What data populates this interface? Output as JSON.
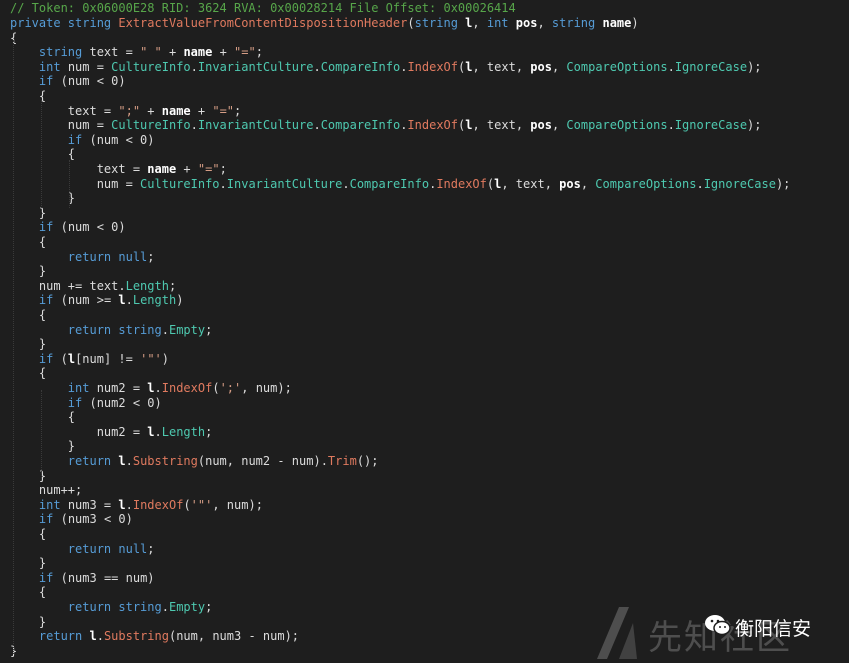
{
  "header_comment": "// Token: 0x06000E28 RID: 3624 RVA: 0x00028214 File Offset: 0x00026414",
  "lines": [
    [
      [
        "kw",
        "private "
      ],
      [
        "kw",
        "string "
      ],
      [
        "fn",
        "ExtractValueFromContentDispositionHeader"
      ],
      [
        "t",
        "("
      ],
      [
        "kw",
        "string "
      ],
      [
        "nm",
        "l"
      ],
      [
        "t",
        ", "
      ],
      [
        "kw",
        "int "
      ],
      [
        "nm",
        "pos"
      ],
      [
        "t",
        ", "
      ],
      [
        "kw",
        "string "
      ],
      [
        "nm",
        "name"
      ],
      [
        "t",
        ")"
      ]
    ],
    [
      [
        "t",
        "{"
      ]
    ],
    [
      [
        "t",
        "    "
      ],
      [
        "kw",
        "string "
      ],
      [
        "t",
        "text = "
      ],
      [
        "st",
        "\" \""
      ],
      [
        "t",
        " + "
      ],
      [
        "nm",
        "name"
      ],
      [
        "t",
        " + "
      ],
      [
        "st",
        "\"=\""
      ],
      [
        "t",
        ";"
      ]
    ],
    [
      [
        "t",
        "    "
      ],
      [
        "kw",
        "int "
      ],
      [
        "t",
        "num = "
      ],
      [
        "ty",
        "CultureInfo"
      ],
      [
        "t",
        "."
      ],
      [
        "pr",
        "InvariantCulture"
      ],
      [
        "t",
        "."
      ],
      [
        "pr",
        "CompareInfo"
      ],
      [
        "t",
        "."
      ],
      [
        "fn",
        "IndexOf"
      ],
      [
        "t",
        "("
      ],
      [
        "nm",
        "l"
      ],
      [
        "t",
        ", text, "
      ],
      [
        "nm",
        "pos"
      ],
      [
        "t",
        ", "
      ],
      [
        "ty",
        "CompareOptions"
      ],
      [
        "t",
        "."
      ],
      [
        "pr",
        "IgnoreCase"
      ],
      [
        "t",
        ");"
      ]
    ],
    [
      [
        "t",
        "    "
      ],
      [
        "kw",
        "if "
      ],
      [
        "t",
        "(num < 0)"
      ]
    ],
    [
      [
        "t",
        "    {"
      ]
    ],
    [
      [
        "t",
        "        text = "
      ],
      [
        "st",
        "\";\""
      ],
      [
        "t",
        " + "
      ],
      [
        "nm",
        "name"
      ],
      [
        "t",
        " + "
      ],
      [
        "st",
        "\"=\""
      ],
      [
        "t",
        ";"
      ]
    ],
    [
      [
        "t",
        "        num = "
      ],
      [
        "ty",
        "CultureInfo"
      ],
      [
        "t",
        "."
      ],
      [
        "pr",
        "InvariantCulture"
      ],
      [
        "t",
        "."
      ],
      [
        "pr",
        "CompareInfo"
      ],
      [
        "t",
        "."
      ],
      [
        "fn",
        "IndexOf"
      ],
      [
        "t",
        "("
      ],
      [
        "nm",
        "l"
      ],
      [
        "t",
        ", text, "
      ],
      [
        "nm",
        "pos"
      ],
      [
        "t",
        ", "
      ],
      [
        "ty",
        "CompareOptions"
      ],
      [
        "t",
        "."
      ],
      [
        "pr",
        "IgnoreCase"
      ],
      [
        "t",
        ");"
      ]
    ],
    [
      [
        "t",
        "        "
      ],
      [
        "kw",
        "if "
      ],
      [
        "t",
        "(num < 0)"
      ]
    ],
    [
      [
        "t",
        "        {"
      ]
    ],
    [
      [
        "t",
        "            text = "
      ],
      [
        "nm",
        "name"
      ],
      [
        "t",
        " + "
      ],
      [
        "st",
        "\"=\""
      ],
      [
        "t",
        ";"
      ]
    ],
    [
      [
        "t",
        "            num = "
      ],
      [
        "ty",
        "CultureInfo"
      ],
      [
        "t",
        "."
      ],
      [
        "pr",
        "InvariantCulture"
      ],
      [
        "t",
        "."
      ],
      [
        "pr",
        "CompareInfo"
      ],
      [
        "t",
        "."
      ],
      [
        "fn",
        "IndexOf"
      ],
      [
        "t",
        "("
      ],
      [
        "nm",
        "l"
      ],
      [
        "t",
        ", text, "
      ],
      [
        "nm",
        "pos"
      ],
      [
        "t",
        ", "
      ],
      [
        "ty",
        "CompareOptions"
      ],
      [
        "t",
        "."
      ],
      [
        "pr",
        "IgnoreCase"
      ],
      [
        "t",
        ");"
      ]
    ],
    [
      [
        "t",
        "        }"
      ]
    ],
    [
      [
        "t",
        "    }"
      ]
    ],
    [
      [
        "t",
        "    "
      ],
      [
        "kw",
        "if "
      ],
      [
        "t",
        "(num < 0)"
      ]
    ],
    [
      [
        "t",
        "    {"
      ]
    ],
    [
      [
        "t",
        "        "
      ],
      [
        "kw",
        "return "
      ],
      [
        "kw",
        "null"
      ],
      [
        "t",
        ";"
      ]
    ],
    [
      [
        "t",
        "    }"
      ]
    ],
    [
      [
        "t",
        "    num += text."
      ],
      [
        "pr",
        "Length"
      ],
      [
        "t",
        ";"
      ]
    ],
    [
      [
        "t",
        "    "
      ],
      [
        "kw",
        "if "
      ],
      [
        "t",
        "(num >= "
      ],
      [
        "nm",
        "l"
      ],
      [
        "t",
        "."
      ],
      [
        "pr",
        "Length"
      ],
      [
        "t",
        ")"
      ]
    ],
    [
      [
        "t",
        "    {"
      ]
    ],
    [
      [
        "t",
        "        "
      ],
      [
        "kw",
        "return "
      ],
      [
        "kw",
        "string"
      ],
      [
        "t",
        "."
      ],
      [
        "pr",
        "Empty"
      ],
      [
        "t",
        ";"
      ]
    ],
    [
      [
        "t",
        "    }"
      ]
    ],
    [
      [
        "t",
        "    "
      ],
      [
        "kw",
        "if "
      ],
      [
        "t",
        "("
      ],
      [
        "nm",
        "l"
      ],
      [
        "t",
        "[num] != "
      ],
      [
        "st",
        "'\"'"
      ],
      [
        "t",
        ")"
      ]
    ],
    [
      [
        "t",
        "    {"
      ]
    ],
    [
      [
        "t",
        "        "
      ],
      [
        "kw",
        "int "
      ],
      [
        "t",
        "num2 = "
      ],
      [
        "nm",
        "l"
      ],
      [
        "t",
        "."
      ],
      [
        "fn",
        "IndexOf"
      ],
      [
        "t",
        "("
      ],
      [
        "st",
        "';'"
      ],
      [
        "t",
        ", num);"
      ]
    ],
    [
      [
        "t",
        "        "
      ],
      [
        "kw",
        "if "
      ],
      [
        "t",
        "(num2 < 0)"
      ]
    ],
    [
      [
        "t",
        "        {"
      ]
    ],
    [
      [
        "t",
        "            num2 = "
      ],
      [
        "nm",
        "l"
      ],
      [
        "t",
        "."
      ],
      [
        "pr",
        "Length"
      ],
      [
        "t",
        ";"
      ]
    ],
    [
      [
        "t",
        "        }"
      ]
    ],
    [
      [
        "t",
        "        "
      ],
      [
        "kw",
        "return "
      ],
      [
        "nm",
        "l"
      ],
      [
        "t",
        "."
      ],
      [
        "fn",
        "Substring"
      ],
      [
        "t",
        "(num, num2 - num)."
      ],
      [
        "fn",
        "Trim"
      ],
      [
        "t",
        "();"
      ]
    ],
    [
      [
        "t",
        "    }"
      ]
    ],
    [
      [
        "t",
        "    num++;"
      ]
    ],
    [
      [
        "t",
        "    "
      ],
      [
        "kw",
        "int "
      ],
      [
        "t",
        "num3 = "
      ],
      [
        "nm",
        "l"
      ],
      [
        "t",
        "."
      ],
      [
        "fn",
        "IndexOf"
      ],
      [
        "t",
        "("
      ],
      [
        "st",
        "'\"'"
      ],
      [
        "t",
        ", num);"
      ]
    ],
    [
      [
        "t",
        "    "
      ],
      [
        "kw",
        "if "
      ],
      [
        "t",
        "(num3 < 0)"
      ]
    ],
    [
      [
        "t",
        "    {"
      ]
    ],
    [
      [
        "t",
        "        "
      ],
      [
        "kw",
        "return "
      ],
      [
        "kw",
        "null"
      ],
      [
        "t",
        ";"
      ]
    ],
    [
      [
        "t",
        "    }"
      ]
    ],
    [
      [
        "t",
        "    "
      ],
      [
        "kw",
        "if "
      ],
      [
        "t",
        "(num3 == num)"
      ]
    ],
    [
      [
        "t",
        "    {"
      ]
    ],
    [
      [
        "t",
        "        "
      ],
      [
        "kw",
        "return "
      ],
      [
        "kw",
        "string"
      ],
      [
        "t",
        "."
      ],
      [
        "pr",
        "Empty"
      ],
      [
        "t",
        ";"
      ]
    ],
    [
      [
        "t",
        "    }"
      ]
    ],
    [
      [
        "t",
        "    "
      ],
      [
        "kw",
        "return "
      ],
      [
        "nm",
        "l"
      ],
      [
        "t",
        "."
      ],
      [
        "fn",
        "Substring"
      ],
      [
        "t",
        "(num, num3 - num);"
      ]
    ],
    [
      [
        "t",
        "}"
      ]
    ]
  ],
  "watermark": {
    "text": "先知社区",
    "brand": "衡阳信安",
    "brand_icon": "wechat-icon"
  },
  "colors": {
    "background": "#1e1e1e",
    "keyword": "#569cd6",
    "method": "#e07a5f",
    "type": "#4ec9b0",
    "string": "#d69d85",
    "comment": "#57a64a"
  }
}
